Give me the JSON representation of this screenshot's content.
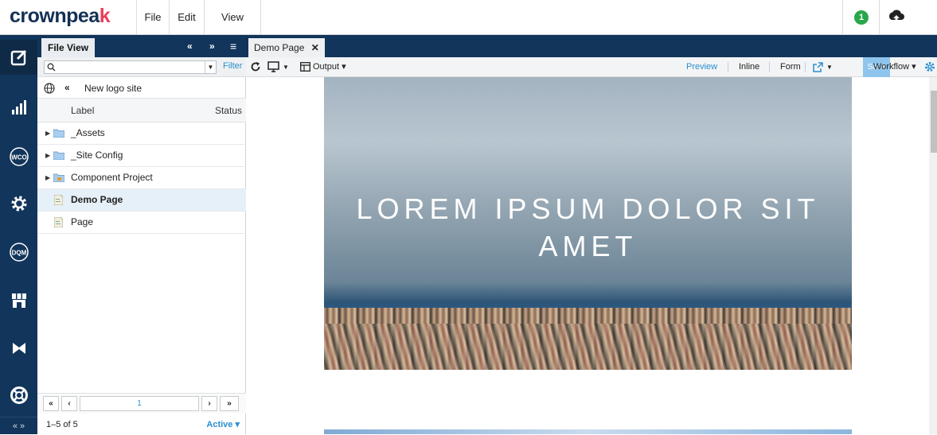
{
  "app": {
    "logo_main": "crownpea",
    "logo_k": "k"
  },
  "menu": {
    "file": "File",
    "edit": "Edit",
    "view": "View"
  },
  "notifications": {
    "count": "1"
  },
  "leftnav": {
    "icons": [
      "edit-icon",
      "analytics-icon",
      "wco-icon",
      "settings-icon",
      "dqm-icon",
      "marketplace-icon",
      "bowtie-icon",
      "help-icon"
    ],
    "wco_label": "WCO",
    "dqm_label": "DQM",
    "collapse": "« »"
  },
  "panel": {
    "tab_label": "File View",
    "prev": "«",
    "next": "»",
    "menu": "≡",
    "filter_label": "Filter",
    "site_name": "New logo site",
    "site_back": "«",
    "col_label": "Label",
    "col_status": "Status",
    "items": [
      {
        "label": "_Assets",
        "type": "folder"
      },
      {
        "label": "_Site Config",
        "type": "folder"
      },
      {
        "label": "Component Project",
        "type": "folder-project"
      },
      {
        "label": "Demo Page",
        "type": "page",
        "selected": true
      },
      {
        "label": "Page",
        "type": "page"
      }
    ],
    "pager": {
      "first": "«",
      "prev": "‹",
      "page": "1",
      "next": "›",
      "last": "»"
    },
    "count_text": "1–5 of 5",
    "status_filter": "Active ▾"
  },
  "document": {
    "tab_label": "Demo Page",
    "close": "✕",
    "toolbar": {
      "output_label": "Output",
      "preview": "Preview",
      "inline": "Inline",
      "form": "Form",
      "save": "Save",
      "workflow": "Workflow"
    },
    "hero_title": "LOREM IPSUM DOLOR SIT AMET"
  },
  "colors": {
    "navy": "#12355b",
    "accent": "#2a8fd0",
    "brand_pink": "#e83e5a",
    "badge": "#27a84a"
  }
}
